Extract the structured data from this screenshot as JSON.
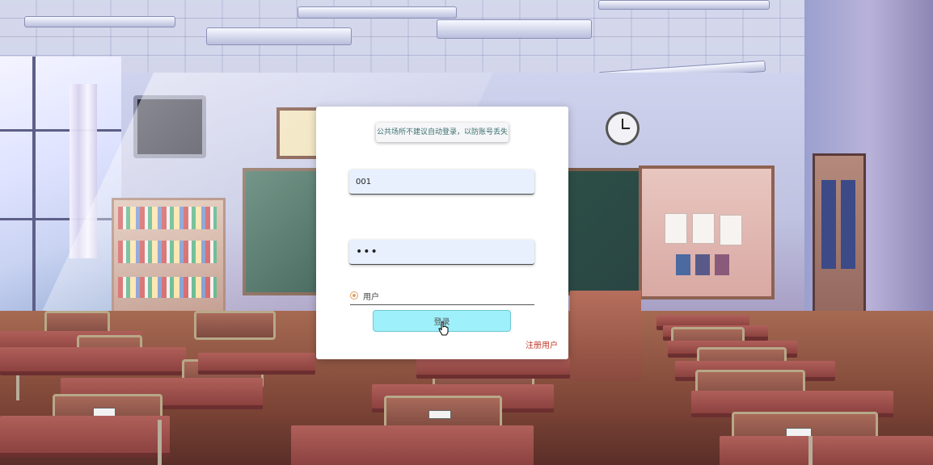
{
  "login": {
    "tip": "公共场所不建议自动登录，以防账号丢失",
    "username_value": "001",
    "password_value": "•••",
    "role_option": "用户",
    "login_button": "登录",
    "register_link": "注册用户"
  },
  "colors": {
    "button_bg": "#9ef0fb",
    "register_link": "#c0392b",
    "input_bg": "#e8f0fe",
    "radio_accent": "#e0a060"
  },
  "icons": [
    "pointer-cursor-icon"
  ]
}
